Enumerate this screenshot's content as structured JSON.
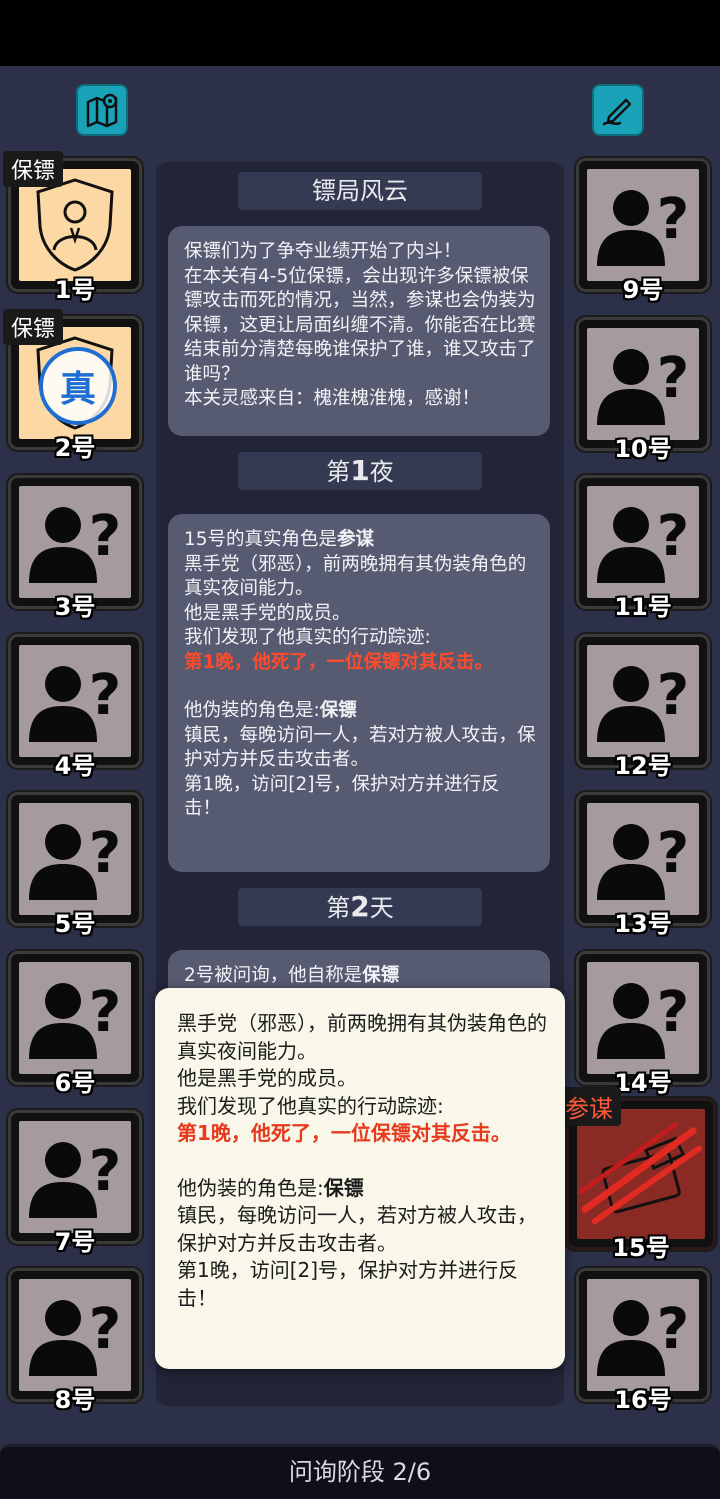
{
  "header": {
    "map_icon": "map-pin-icon",
    "notes_icon": "pen-edit-icon"
  },
  "players_left": [
    {
      "number": "1号",
      "tag": "保镖",
      "revealed": true
    },
    {
      "number": "2号",
      "tag": "保镖",
      "revealed": true,
      "stamp": "真"
    },
    {
      "number": "3号"
    },
    {
      "number": "4号"
    },
    {
      "number": "5号"
    },
    {
      "number": "6号"
    },
    {
      "number": "7号"
    },
    {
      "number": "8号"
    }
  ],
  "players_right": [
    {
      "number": "9号"
    },
    {
      "number": "10号"
    },
    {
      "number": "11号"
    },
    {
      "number": "12号"
    },
    {
      "number": "13号"
    },
    {
      "number": "14号"
    },
    {
      "number": "15号",
      "tag": "参谋",
      "revealed": true
    },
    {
      "number": "16号"
    }
  ],
  "log": {
    "title": "镖局风云",
    "intro": "保镖们为了争夺业绩开始了内斗！\n在本关有4-5位保镖，会出现许多保镖被保镖攻击而死的情况，当然，参谋也会伪装为保镖，这更让局面纠缠不清。你能否在比赛结束前分清楚每晚谁保护了谁，谁又攻击了谁吗？\n本关灵感来自：槐淮槐淮槐，感谢！",
    "night1_prefix": "第",
    "night1_num": "1",
    "night1_suffix": "夜",
    "night1_line1_a": "15号的真实角色是",
    "night1_line1_b": "参谋",
    "night1_body": "黑手党（邪恶），前两晚拥有其伪装角色的真实夜间能力。\n他是黑手党的成员。\n我们发现了他真实的行动踪迹:",
    "night1_red": "第1晚，他死了，一位保镖对其反击。",
    "night1_disguise_a": "他伪装的角色是:",
    "night1_disguise_b": "保镖",
    "night1_body2": "镇民，每晚访问一人，若对方被人攻击，保护对方并反击攻击者。\n第1晚，访问[2]号，保护对方并进行反击！",
    "day2_prefix": "第",
    "day2_num": "2",
    "day2_suffix": "天",
    "day2_peek_a": "2号被问询，他自称是",
    "day2_peek_b": "保镖"
  },
  "popup": {
    "body": "黑手党（邪恶），前两晚拥有其伪装角色的真实夜间能力。\n他是黑手党的成员。\n我们发现了他真实的行动踪迹:",
    "red": "第1晚，他死了，一位保镖对其反击。",
    "disguise_a": "他伪装的角色是:",
    "disguise_b": "保镖",
    "body2": "镇民，每晚访问一人，若对方被人攻击，保护对方并反击攻击者。\n第1晚，访问[2]号，保护对方并进行反击！"
  },
  "footer": {
    "phase": "问询阶段 2/6"
  },
  "colors": {
    "accent_teal": "#1aa3b8",
    "revealed_bg": "#fcd9a4",
    "unknown_bg": "#a59aa0",
    "red_text": "#ff4b2b",
    "counselor_red": "#b21d1d"
  }
}
